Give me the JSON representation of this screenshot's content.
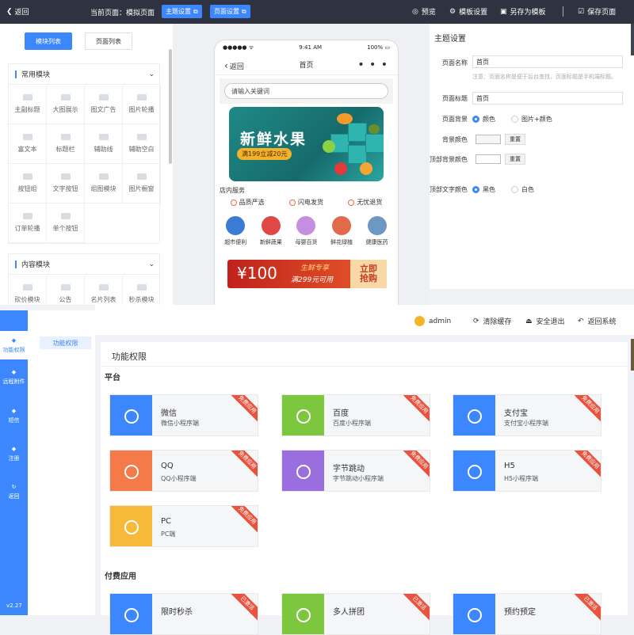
{
  "topbar": {
    "back": "返回",
    "current_page": "当前页面：模拟页面",
    "theme_btn": "主题设置",
    "page_btn": "页面设置",
    "preview": "预览",
    "template_settings": "模板设置",
    "save_as_template": "另存为模板",
    "save_page": "保存页面"
  },
  "left_panel": {
    "tabs": [
      "模块列表",
      "页面列表"
    ],
    "groups": [
      {
        "title": "常用模块",
        "items": [
          "主副标题",
          "大图展示",
          "图文广告",
          "图片轮播",
          "富文本",
          "标题栏",
          "辅助线",
          "辅助空白",
          "按钮组",
          "文字按钮",
          "组图模块",
          "图片橱窗",
          "订单轮播",
          "单个按钮"
        ]
      },
      {
        "title": "内容模块",
        "items": [
          "砍价模块",
          "公告",
          "名片列表",
          "秒杀模块"
        ]
      }
    ]
  },
  "phone": {
    "status_left": "●●●●● ᯤ",
    "status_time": "9:41 AM",
    "status_right": "100% ▭",
    "nav_back": "返回",
    "nav_title": "首页",
    "nav_more": "• • •",
    "search_placeholder": "请输入关键词",
    "banner_title": "新鲜水果",
    "banner_promo": "满199立减20元",
    "service_title": "店内服务",
    "services": [
      "品质严选",
      "闪电发货",
      "无忧退货"
    ],
    "categories": [
      {
        "label": "超市便利",
        "color": "#3a7bd5"
      },
      {
        "label": "新鲜蔬果",
        "color": "#e04848"
      },
      {
        "label": "母婴百货",
        "color": "#c48fe0"
      },
      {
        "label": "鲜花绿植",
        "color": "#e06a4a"
      },
      {
        "label": "健康医药",
        "color": "#6e98c4"
      }
    ],
    "coupon_amount": "¥100",
    "coupon_line1": "生鲜专享",
    "coupon_line2": "满299元可用",
    "coupon_grab1": "立即",
    "coupon_grab2": "抢购"
  },
  "right_panel": {
    "title": "主题设置",
    "page_name_label": "页面名称",
    "page_name_value": "首页",
    "hint": "注意：页面名称是便于后台查找，页面标题是手机端标题。",
    "page_title_label": "页面标题",
    "page_title_value": "首页",
    "bg_label": "页面背景",
    "bg_opt1": "颜色",
    "bg_opt2": "图片+颜色",
    "bg_color_label": "背景颜色",
    "reset": "重置",
    "top_bg_label": "顶部背景颜色",
    "top_text_label": "顶部文字颜色",
    "text_opt1": "黑色",
    "text_opt2": "白色"
  },
  "admin": {
    "user": "admin",
    "clear_cache": "清除缓存",
    "logout": "安全退出",
    "back_system": "返回系统",
    "sidebar": [
      "功能权限",
      "远程附件",
      "短信",
      "注册",
      "返回"
    ],
    "version": "v2.27",
    "submenu_item": "功能权限",
    "content_title": "功能权限",
    "section_platform": "平台",
    "section_paid": "付费应用",
    "free_badge": "免费应用",
    "active_badge": "已激活",
    "platforms": [
      {
        "name": "微信",
        "desc": "微信小程序端",
        "color": "#3c87fd"
      },
      {
        "name": "百度",
        "desc": "百度小程序端",
        "color": "#7dc73f"
      },
      {
        "name": "支付宝",
        "desc": "支付宝小程序端",
        "color": "#3c87fd"
      },
      {
        "name": "QQ",
        "desc": "QQ小程序端",
        "color": "#f47a4a"
      },
      {
        "name": "字节跳动",
        "desc": "字节跳动小程序端",
        "color": "#9b6ee0"
      },
      {
        "name": "H5",
        "desc": "H5小程序端",
        "color": "#3c87fd"
      },
      {
        "name": "PC",
        "desc": "PC端",
        "color": "#f7b93a"
      }
    ],
    "paid": [
      {
        "name": "限时秒杀",
        "color": "#3c87fd"
      },
      {
        "name": "多人拼团",
        "color": "#7dc73f"
      },
      {
        "name": "预约预定",
        "color": "#3c87fd"
      }
    ]
  }
}
